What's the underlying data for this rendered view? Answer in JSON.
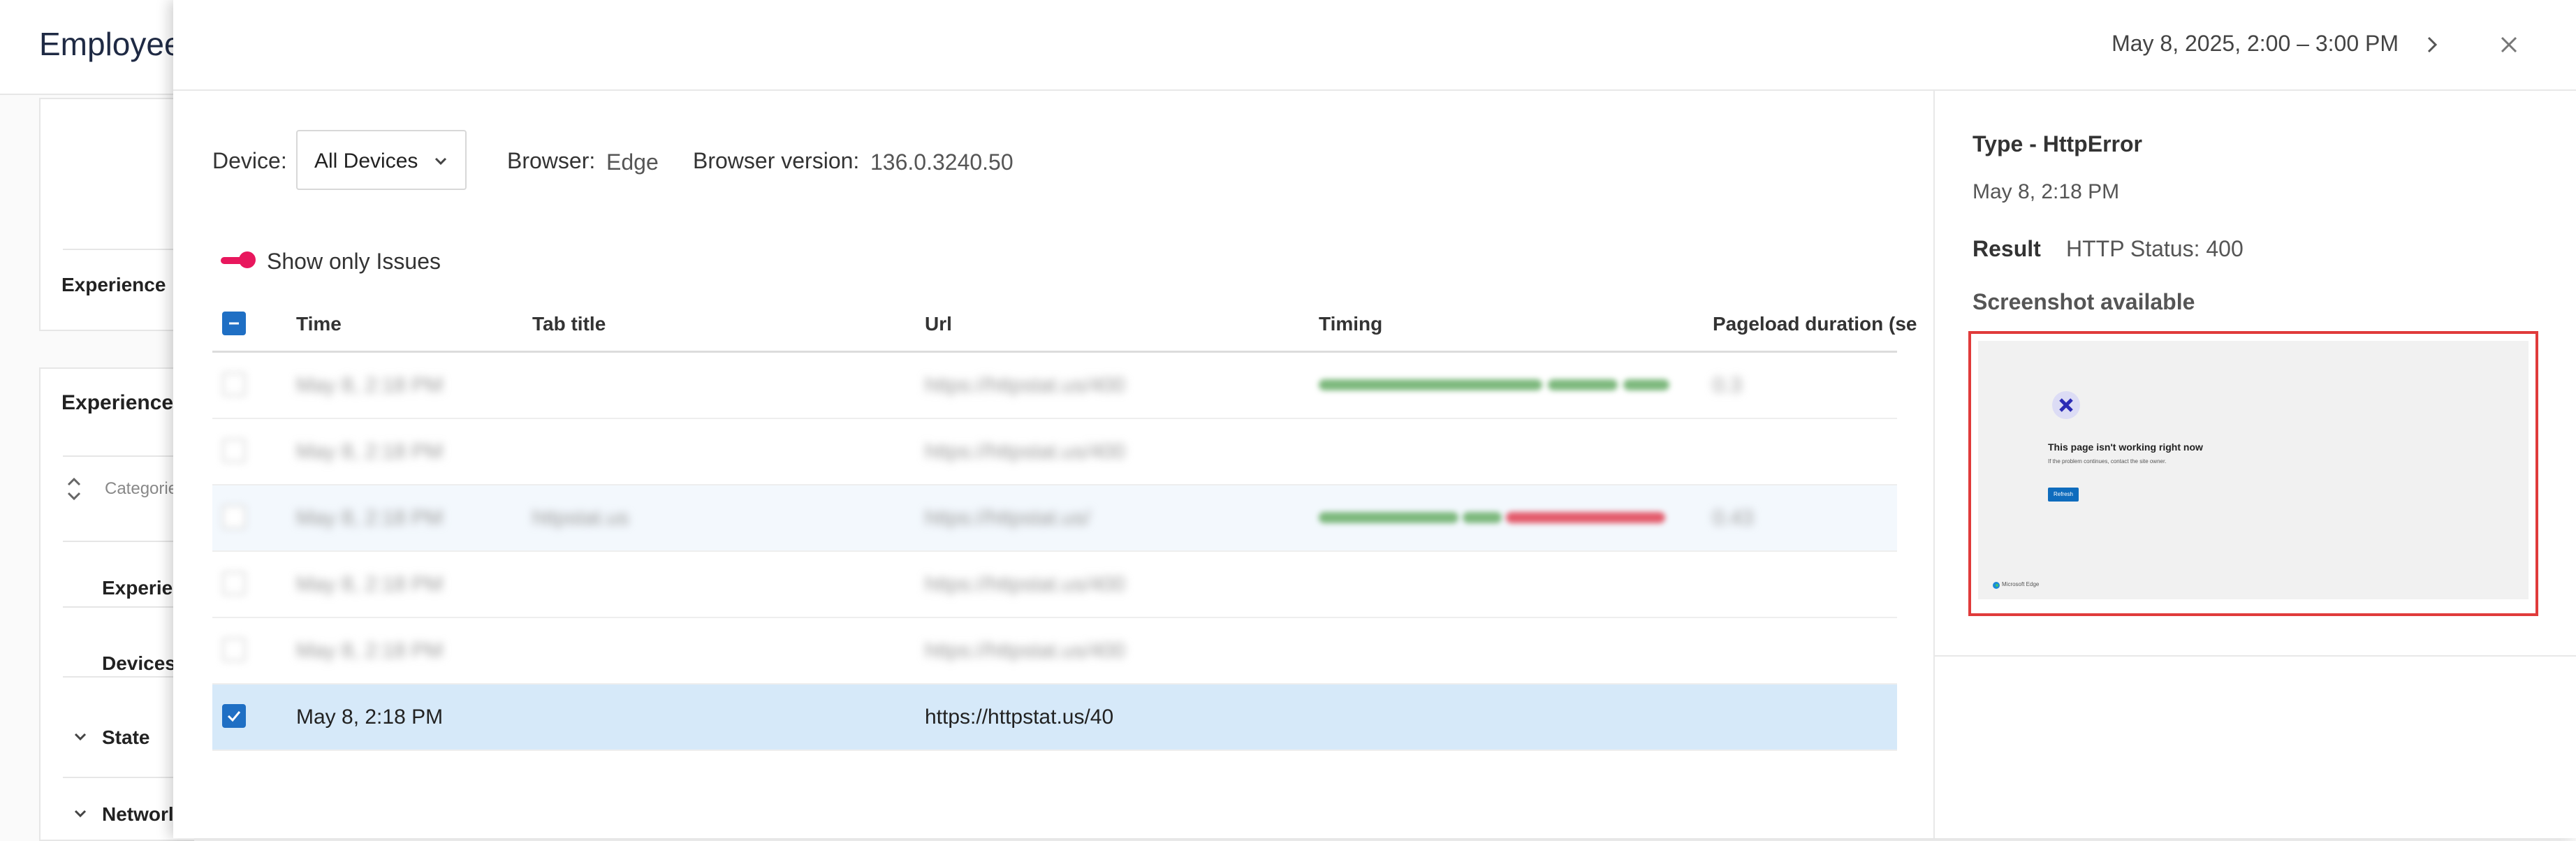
{
  "background": {
    "header_title": "Employee",
    "card1_label": "Experience",
    "card2_title": "Experience",
    "sort_label": "Categorie",
    "items": [
      "Experien",
      "Devices",
      "State",
      "Networl"
    ]
  },
  "modal": {
    "date_range": "May 8, 2025, 2:00 – 3:00 PM",
    "filters": {
      "device_label": "Device:",
      "device_value": "All Devices",
      "browser_label": "Browser:",
      "browser_value": "Edge",
      "browser_version_label": "Browser version:",
      "browser_version_value": "136.0.3240.50"
    },
    "toggle": {
      "label": "Show only Issues",
      "on": true,
      "color": "#e8175d"
    },
    "table": {
      "columns": [
        "Time",
        "Tab title",
        "Url",
        "Timing",
        "Pageload duration (se"
      ],
      "rows": [
        {
          "time": "May 8, 2:18 PM",
          "tab_title": "",
          "url": "https://httpstat.us/400",
          "duration": "0.3",
          "blurred": true
        },
        {
          "time": "May 8, 2:18 PM",
          "tab_title": "",
          "url": "https://httpstat.us/400",
          "duration": "",
          "blurred": true
        },
        {
          "time": "May 8, 2:18 PM",
          "tab_title": "httpstat.us",
          "url": "https://httpstat.us/",
          "duration": "0.43",
          "blurred": true
        },
        {
          "time": "May 8, 2:18 PM",
          "tab_title": "",
          "url": "https://httpstat.us/400",
          "duration": "",
          "blurred": true
        },
        {
          "time": "May 8, 2:18 PM",
          "tab_title": "",
          "url": "https://httpstat.us/400",
          "duration": "",
          "blurred": true
        },
        {
          "time": "May 8, 2:18 PM",
          "tab_title": "",
          "url": "https://httpstat.us/40",
          "duration": "",
          "blurred": false,
          "selected": true
        }
      ]
    }
  },
  "side_panel": {
    "type_label": "Type - HttpError",
    "timestamp": "May 8, 2:18 PM",
    "result_label": "Result",
    "result_value": "HTTP Status: 400",
    "screenshot_label": "Screenshot available",
    "screenshot": {
      "heading": "This page isn't working right now",
      "sub": "If the problem continues, contact the site owner.",
      "button": "Refresh",
      "brand": "Microsoft Edge"
    }
  },
  "colors": {
    "accent": "#1f6fc4",
    "highlight_border": "#e03b3b",
    "selected_row": "#d6e9f9"
  }
}
